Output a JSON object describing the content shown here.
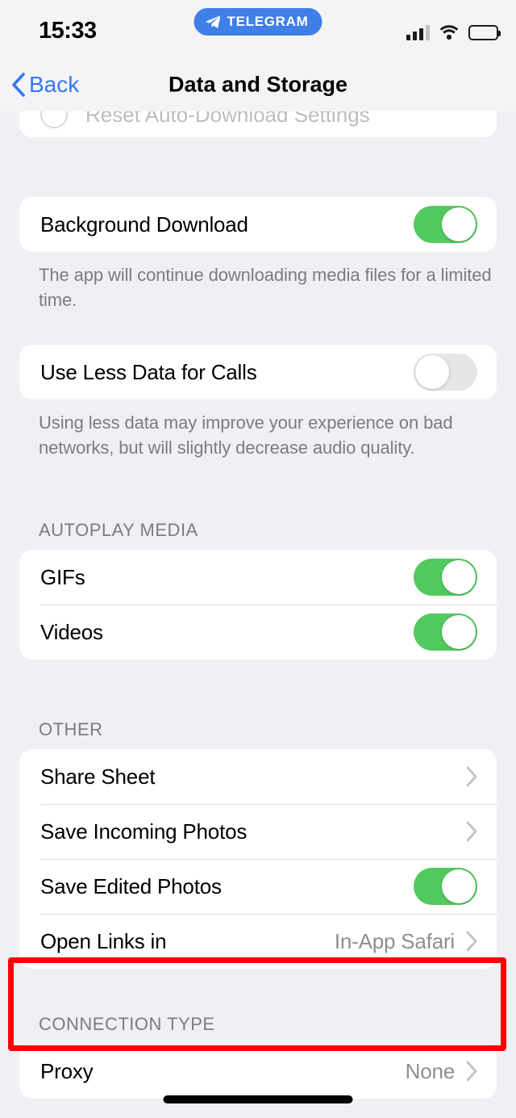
{
  "status_bar": {
    "time": "15:33",
    "app_badge": "TELEGRAM",
    "icons": [
      "cellular-signal-icon",
      "wifi-icon",
      "battery-icon"
    ]
  },
  "nav_bar": {
    "back_label": "Back",
    "title": "Data and Storage"
  },
  "clipped_row": {
    "label": "Reset Auto-Download Settings"
  },
  "sections": {
    "background_download": {
      "row_label": "Background Download",
      "toggle_state": "on",
      "footnote": "The app will continue downloading media files for a limited time."
    },
    "use_less_data": {
      "row_label": "Use Less Data for Calls",
      "toggle_state": "off",
      "footnote": "Using less data may improve your experience on bad networks, but will slightly decrease audio quality."
    },
    "autoplay_media": {
      "header": "AUTOPLAY MEDIA",
      "rows": [
        {
          "label": "GIFs",
          "toggle_state": "on"
        },
        {
          "label": "Videos",
          "toggle_state": "on"
        }
      ]
    },
    "other": {
      "header": "OTHER",
      "rows": [
        {
          "label": "Share Sheet",
          "value": "",
          "accessory": "chevron"
        },
        {
          "label": "Save Incoming Photos",
          "value": "",
          "accessory": "chevron"
        },
        {
          "label": "Save Edited Photos",
          "value": "",
          "accessory": "toggle",
          "toggle_state": "on"
        },
        {
          "label": "Open Links in",
          "value": "In-App Safari",
          "accessory": "chevron"
        }
      ]
    },
    "connection_type": {
      "header": "CONNECTION TYPE",
      "rows": [
        {
          "label": "Proxy",
          "value": "None",
          "accessory": "chevron"
        }
      ]
    }
  },
  "annotation": {
    "highlight_color": "#FF0000",
    "highlights": "proxy-row"
  },
  "colors": {
    "background": "#EFEFF4",
    "card": "#FFFFFF",
    "accent_blue": "#3478F6",
    "toggle_on": "#52C95E",
    "toggle_off": "#E6E6E8",
    "secondary_text": "#8E8E93",
    "telegram_blue": "#3E7FE8"
  }
}
